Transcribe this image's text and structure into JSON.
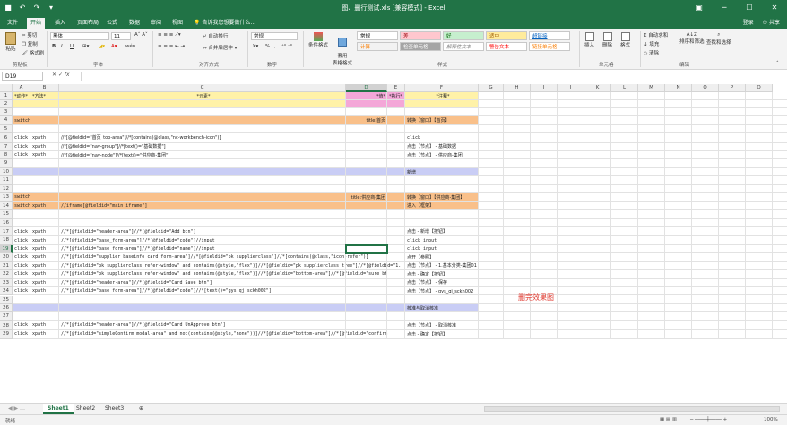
{
  "window": {
    "title": "图、删行测试.xls [兼容模式] - Excel",
    "save_icon": "save-icon",
    "undo_icon": "undo-icon",
    "redo_icon": "redo-icon"
  },
  "ribbon_tabs": [
    "文件",
    "开始",
    "插入",
    "页面布局",
    "公式",
    "数据",
    "审阅",
    "视图"
  ],
  "active_tab": "开始",
  "tell_me": "告诉我您想要做什么...",
  "account": {
    "login": "登录",
    "share": "共享"
  },
  "ribbon": {
    "clipboard": {
      "paste": "粘贴",
      "cut": "剪切",
      "copy": "复制",
      "format_painter": "格式刷",
      "label": "剪贴板"
    },
    "font": {
      "font_name": "黑体",
      "font_size": "11",
      "bold": "B",
      "italic": "I",
      "underline": "U",
      "wen": "wén",
      "label": "字体"
    },
    "alignment": {
      "wrap": "自动换行",
      "merge": "合并后居中",
      "label": "对齐方式"
    },
    "number": {
      "format": "常规",
      "percent": "%",
      "comma": ",",
      "label": "数字"
    },
    "styles": {
      "conditional": "条件格式",
      "table": "套用\n表格格式",
      "cells": [
        {
          "label": "常规",
          "bg": "#ffffff",
          "fg": "#000000"
        },
        {
          "label": "差",
          "bg": "#ffc7ce",
          "fg": "#9c0006"
        },
        {
          "label": "好",
          "bg": "#c6efce",
          "fg": "#006100"
        },
        {
          "label": "适中",
          "bg": "#ffeb9c",
          "fg": "#9c5700"
        },
        {
          "label": "超链接",
          "bg": "#ffffff",
          "fg": "#0563c1"
        },
        {
          "label": "计算",
          "bg": "#f2f2f2",
          "fg": "#fa7d00"
        },
        {
          "label": "检查单元格",
          "bg": "#a5a5a5",
          "fg": "#ffffff"
        },
        {
          "label": "解释性文本",
          "bg": "#ffffff",
          "fg": "#7f7f7f"
        },
        {
          "label": "警告文本",
          "bg": "#ffffff",
          "fg": "#ff0000"
        },
        {
          "label": "链接单元格",
          "bg": "#ffffff",
          "fg": "#fa7d00"
        }
      ],
      "label": "样式"
    },
    "cells_group": {
      "insert": "插入",
      "delete": "删除",
      "format": "格式",
      "label": "单元格"
    },
    "editing": {
      "autosum": "自动求和",
      "fill": "填充",
      "clear": "清除",
      "sort": "排序和筛选",
      "find": "查找和选择",
      "label": "编辑"
    }
  },
  "formula_bar": {
    "name_box": "D19",
    "fx": "fx",
    "value": ""
  },
  "columns": [
    {
      "label": "A"
    },
    {
      "label": "B"
    },
    {
      "label": "C"
    },
    {
      "label": "D"
    },
    {
      "label": "E"
    },
    {
      "label": "F"
    },
    {
      "label": "G"
    },
    {
      "label": "H"
    },
    {
      "label": "I"
    },
    {
      "label": "J"
    },
    {
      "label": "K"
    },
    {
      "label": "L"
    },
    {
      "label": "M"
    },
    {
      "label": "N"
    },
    {
      "label": "O"
    },
    {
      "label": "P"
    },
    {
      "label": "Q"
    }
  ],
  "selected": {
    "col": "D",
    "row": "19"
  },
  "rows": [
    {
      "n": "1",
      "fill": {
        "A": "#fff2a8",
        "B": "#fff2a8",
        "C": "#fff2a8",
        "D": "#f4a7d8",
        "E": "#f4a7d8",
        "F": "#fff2a8"
      },
      "cells": {
        "A": "*动作*",
        "B": "*方法*",
        "C": "*元素*",
        "D": "*值*",
        "E": "*执行*",
        "F": "*注释*"
      },
      "styles": {
        "C": "center",
        "D": "right",
        "F": "center"
      }
    },
    {
      "n": "2",
      "fill": {
        "A": "#fff2a8",
        "B": "#fff2a8",
        "C": "#fff2a8",
        "D": "#f4a7d8",
        "E": "#f4a7d8",
        "F": "#fff2a8"
      },
      "cells": {}
    },
    {
      "n": "3",
      "cells": {}
    },
    {
      "n": "4",
      "fill": {
        "ALL": "#f9c08a"
      },
      "cells": {
        "A": "switch",
        "D": "title:首页",
        "F": "转换【窗口】【首页】"
      },
      "styles": {
        "D": "right"
      }
    },
    {
      "n": "5",
      "cells": {}
    },
    {
      "n": "6",
      "cells": {
        "A": "click",
        "B": "xpath",
        "C": "//*[@fieldid=\"首页_top-area\"]//*[contains(@class,\"nc-workbench-icon\")]",
        "F": "click"
      }
    },
    {
      "n": "7",
      "cells": {
        "A": "click",
        "B": "xpath",
        "C": "//*[@fieldid=\"nav-group\"]//*[text()=\"基础数据\"]",
        "F": "点击【节点】 - 基础数据"
      }
    },
    {
      "n": "8",
      "cells": {
        "A": "click",
        "B": "xpath",
        "C": "//*[@fieldid=\"nav-node\"]//*[text()=\"供应商-集团\"]",
        "F": "点击【节点】 - 供应商-集团"
      }
    },
    {
      "n": "9",
      "cells": {}
    },
    {
      "n": "10",
      "fill": {
        "ALL": "#c9cdf5"
      },
      "cells": {
        "F": "新增"
      }
    },
    {
      "n": "11",
      "cells": {}
    },
    {
      "n": "12",
      "cells": {}
    },
    {
      "n": "13",
      "fill": {
        "ALL": "#f9c08a"
      },
      "cells": {
        "A": "switch",
        "D": "title:供应商-集团",
        "F": "转换【窗口】【供应商-集团】"
      },
      "styles": {
        "D": "right"
      }
    },
    {
      "n": "14",
      "fill": {
        "ALL": "#f9c08a"
      },
      "cells": {
        "A": "switch",
        "B": "xpath",
        "C": "//iframe[@fieldid=\"main_iframe\"]",
        "F": "进入【框架】"
      }
    },
    {
      "n": "15",
      "cells": {}
    },
    {
      "n": "16",
      "cells": {}
    },
    {
      "n": "17",
      "cells": {
        "A": "click",
        "B": "xpath",
        "C": "//*[@fieldid=\"header-area\"]//*[@fieldid=\"Add_btn\"]",
        "F": "点击 - 新增【按钮】"
      }
    },
    {
      "n": "18",
      "cells": {
        "A": "click",
        "B": "xpath",
        "C": "//*[@fieldid=\"base_form-area\"]//*[@fieldid=\"code\"]//input",
        "F": "click input"
      }
    },
    {
      "n": "19",
      "cells": {
        "A": "click",
        "B": "xpath",
        "C": "//*[@fieldid=\"base_form-area\"]//*[@fieldid=\"name\"]//input",
        "F": "click input"
      }
    },
    {
      "n": "20",
      "cells": {
        "A": "click",
        "B": "xpath",
        "C": "//*[@fieldid=\"supplier_baseinfo_card_form-area\"]//*[@fieldid=\"pk_supplierclass\"]//*[contains(@class,\"icon-refer\")]",
        "F": "点开【参照】"
      }
    },
    {
      "n": "21",
      "cells": {
        "A": "click",
        "B": "xpath",
        "C": "//*[@fieldid=\"pk_supplierclass_refer-window\" and contains(@style,\"flex\")]//*[@fieldid=\"pk_supplierclass_tree\"]//*[@fieldid=\"1.",
        "F": "点击【节点】 - 1.基本分类-集团01"
      }
    },
    {
      "n": "22",
      "cells": {
        "A": "click",
        "B": "xpath",
        "C": "//*[@fieldid=\"pk_supplierclass_refer-window\" and contains(@style,\"flex\")]//*[@fieldid=\"bottom-area\"]//*[@fieldid=\"sure_bt",
        "F": "点击 - 确定【按钮】"
      }
    },
    {
      "n": "23",
      "cells": {
        "A": "click",
        "B": "xpath",
        "C": "//*[@fieldid=\"header-area\"]//*[@fieldid=\"Card_Save_btn\"]",
        "F": "点击【节点】 - 保存"
      }
    },
    {
      "n": "24",
      "cells": {
        "A": "click",
        "B": "xpath",
        "C": "//*[@fieldid=\"base_form-area\"]//*[@fieldid=\"code\"]//*[text()=\"gys_qj_sckh002\"]",
        "F": "点击【节点】 - gys_qj_sckh002"
      }
    },
    {
      "n": "25",
      "cells": {}
    },
    {
      "n": "26",
      "fill": {
        "ALL": "#c9cdf5"
      },
      "cells": {
        "F": "核准与取消核准"
      }
    },
    {
      "n": "27",
      "cells": {}
    },
    {
      "n": "28",
      "cells": {
        "A": "click",
        "B": "xpath",
        "C": "//*[@fieldid=\"header-area\"]//*[@fieldid=\"Card_UnApprove_btn\"]",
        "F": "点击【节点】 - 取消核准"
      }
    },
    {
      "n": "29",
      "cells": {
        "A": "click",
        "B": "xpath",
        "C": "//*[@fieldid=\"simpleConfirm_modal-area\" and not(contains(@style,\"none\"))]//*[@fieldid=\"bottom-area\"]//*[@fieldid=\"confirm",
        "F": "点击 - 确定【按钮】"
      }
    }
  ],
  "note": "删完效果图",
  "sheets": [
    "Sheet1",
    "Sheet2",
    "Sheet3"
  ],
  "active_sheet": "Sheet1",
  "status": {
    "ready": "就绪",
    "zoom": "100%"
  }
}
